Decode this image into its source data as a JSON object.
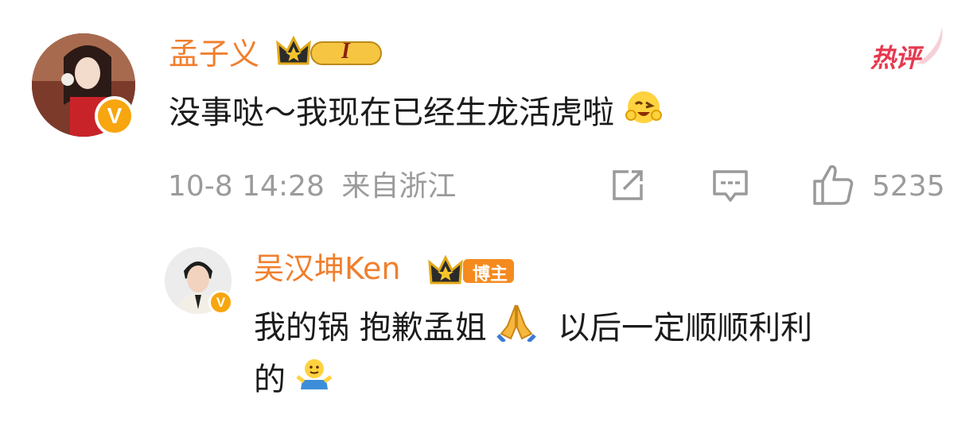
{
  "comment": {
    "author": "孟子义",
    "level_badge": "I",
    "hot_label": "热评",
    "text": "没事哒～我现在已经生龙活虎啦",
    "emoji": "grinning-wink-emoji",
    "timestamp": "10-8 14:28",
    "location": "来自浙江",
    "like_count": "5235"
  },
  "reply": {
    "author": "吴汉坤Ken",
    "role_badge": "博主",
    "text_line1_part1": "我的锅 抱歉孟姐",
    "text_line1_part2": "以后一定顺顺利利",
    "text_line2": "的",
    "emoji_pray": "folded-hands-emoji",
    "emoji_shrug": "shrug-emoji"
  },
  "colors": {
    "name": "#f07f2e",
    "hot": "#e6394f",
    "meta": "#9b9b9b",
    "text": "#1b1b1b",
    "verified": "#f7a60f"
  }
}
